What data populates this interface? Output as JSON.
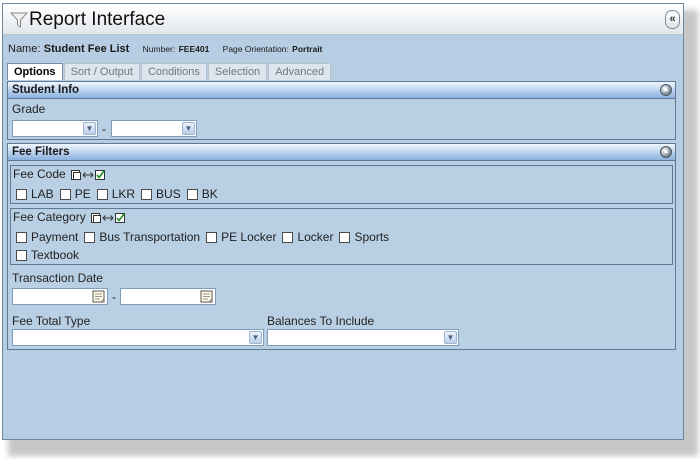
{
  "title": "Report Interface",
  "collapse_glyph": "«",
  "report": {
    "name_label": "Name:",
    "name": "Student Fee List",
    "number_label": "Number:",
    "number": "FEE401",
    "orientation_label": "Page Orientation:",
    "orientation": "Portrait"
  },
  "tabs": [
    {
      "label": "Options",
      "active": true
    },
    {
      "label": "Sort / Output",
      "active": false
    },
    {
      "label": "Conditions",
      "active": false
    },
    {
      "label": "Selection",
      "active": false
    },
    {
      "label": "Advanced",
      "active": false
    }
  ],
  "student_info": {
    "header": "Student Info",
    "grade_label": "Grade",
    "grade_from": "",
    "grade_to": "",
    "range_separator": "-"
  },
  "fee_filters": {
    "header": "Fee Filters",
    "fee_code": {
      "label": "Fee Code",
      "options": [
        "LAB",
        "PE",
        "LKR",
        "BUS",
        "BK"
      ]
    },
    "fee_category": {
      "label": "Fee Category",
      "options": [
        "Payment",
        "Bus Transportation",
        "PE Locker",
        "Locker",
        "Sports",
        "Textbook"
      ]
    },
    "transaction_date": {
      "label": "Transaction Date",
      "from": "",
      "to": "",
      "range_separator": "-"
    },
    "fee_total_type": {
      "label": "Fee Total Type",
      "value": ""
    },
    "balances_to_include": {
      "label": "Balances To Include",
      "value": ""
    }
  },
  "colors": {
    "window_bg": "#b7cde3",
    "panel_header_top": "#f0f7ff",
    "panel_header_bottom": "#8ab1de",
    "border": "#5f7893"
  },
  "icons": {
    "title": "filter-funnel-icon",
    "select_all": "select-all-icon",
    "swap": "swap-arrows-icon",
    "check_all": "check-all-icon",
    "calendar": "calendar-icon",
    "dropdown": "chevron-down-icon",
    "panel_toggle": "collapse-circle-icon"
  }
}
